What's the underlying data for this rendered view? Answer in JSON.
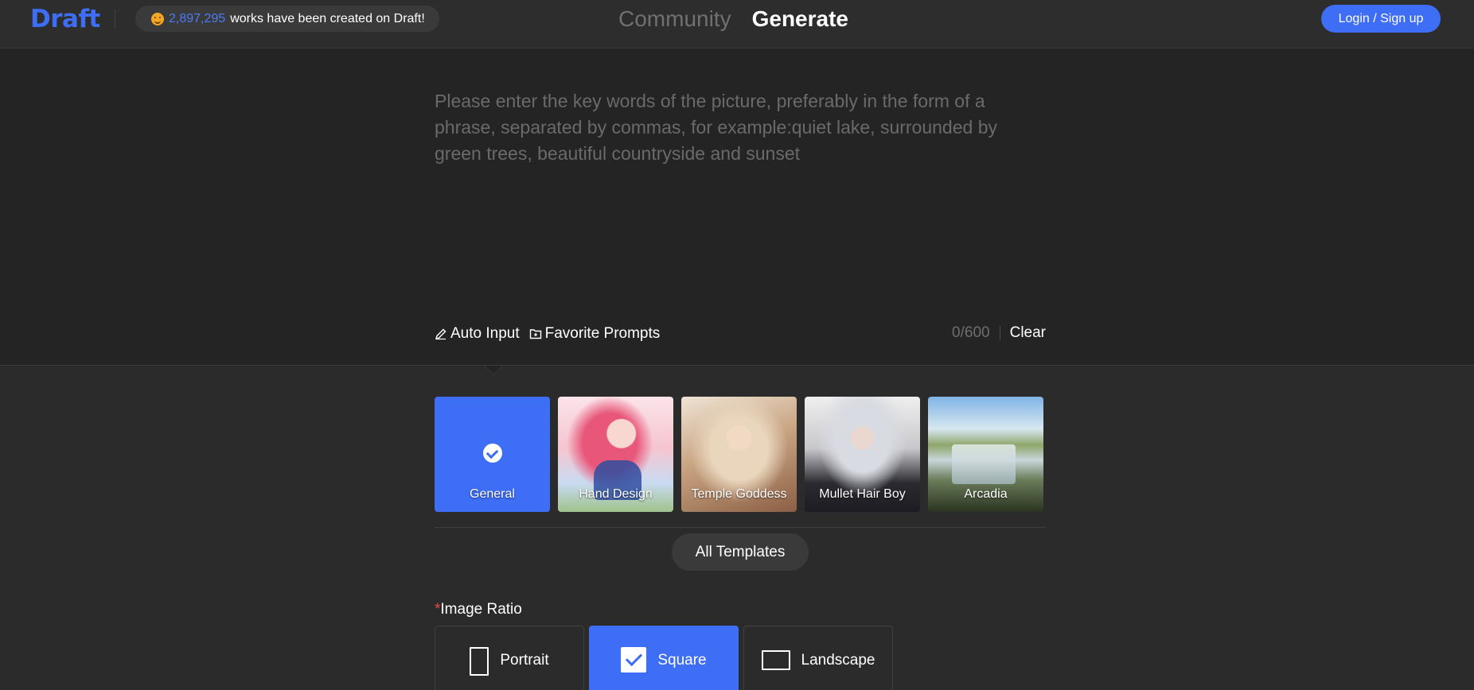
{
  "header": {
    "logo": "Draft",
    "counter": {
      "number": "2,897,295",
      "text": "works have been created on Draft!"
    },
    "tabs": [
      {
        "label": "Community",
        "active": false
      },
      {
        "label": "Generate",
        "active": true
      }
    ],
    "login_label": "Login / Sign up"
  },
  "prompt": {
    "value": "",
    "placeholder": "Please enter the key words of the picture, preferably in the form of a phrase, separated by commas, for example:quiet lake, surrounded by green trees, beautiful countryside and sunset",
    "auto_input_label": "Auto Input",
    "favorite_label": "Favorite Prompts",
    "char_count": "0/600",
    "clear_label": "Clear"
  },
  "templates": {
    "items": [
      {
        "label": "General",
        "selected": true
      },
      {
        "label": "Hand Design",
        "selected": false
      },
      {
        "label": "Temple Goddess",
        "selected": false
      },
      {
        "label": "Mullet Hair Boy",
        "selected": false
      },
      {
        "label": "Arcadia",
        "selected": false
      }
    ],
    "all_label": "All Templates"
  },
  "ratio": {
    "required_mark": "*",
    "label": "Image Ratio",
    "options": [
      {
        "label": "Portrait",
        "selected": false
      },
      {
        "label": "Square",
        "selected": true
      },
      {
        "label": "Landscape",
        "selected": false
      }
    ]
  },
  "colors": {
    "accent": "#3d6ef5",
    "background": "#2b2b2b",
    "prompt_background": "#242424"
  }
}
